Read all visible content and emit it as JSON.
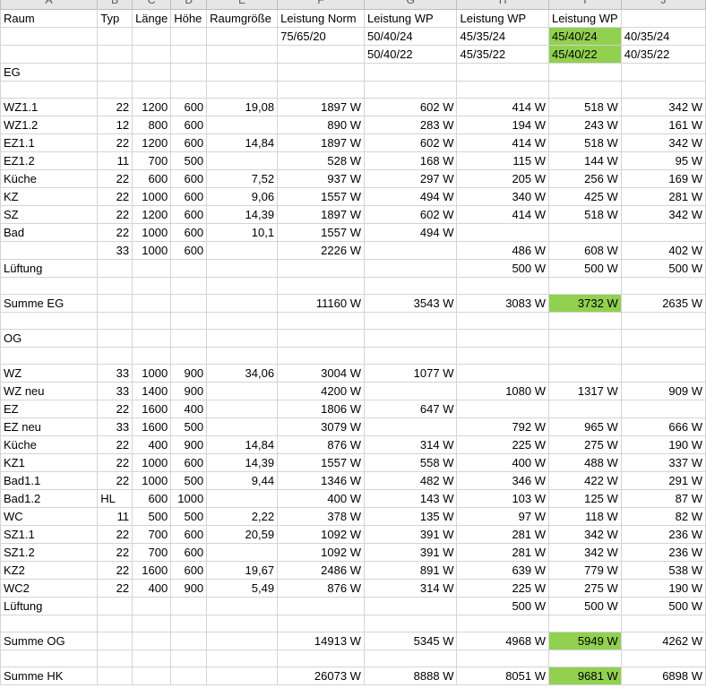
{
  "columns": [
    "A",
    "B",
    "C",
    "D",
    "E",
    "F",
    "G",
    "H",
    "I",
    "J"
  ],
  "highlight_color": "#92d050",
  "rows": [
    [
      "Raum",
      "Typ",
      "Länge",
      "Höhe",
      "Raumgröße",
      "Leistung Norm",
      "Leistung WP",
      "Leistung WP",
      "Leistung WP",
      ""
    ],
    [
      "",
      "",
      "",
      "",
      "",
      "75/65/20",
      "50/40/24",
      "45/35/24",
      "45/40/24",
      "40/35/24"
    ],
    [
      "",
      "",
      "",
      "",
      "",
      "",
      "50/40/22",
      "45/35/22",
      "45/40/22",
      "40/35/22"
    ],
    [
      "EG",
      "",
      "",
      "",
      "",
      "",
      "",
      "",
      "",
      ""
    ],
    [
      "",
      "",
      "",
      "",
      "",
      "",
      "",
      "",
      "",
      ""
    ],
    [
      "WZ1.1",
      "22",
      "1200",
      "600",
      "19,08",
      "1897 W",
      "602 W",
      "414 W",
      "518 W",
      "342 W"
    ],
    [
      "WZ1.2",
      "12",
      "800",
      "600",
      "",
      "890 W",
      "283 W",
      "194 W",
      "243 W",
      "161 W"
    ],
    [
      "EZ1.1",
      "22",
      "1200",
      "600",
      "14,84",
      "1897 W",
      "602 W",
      "414 W",
      "518 W",
      "342 W"
    ],
    [
      "EZ1.2",
      "11",
      "700",
      "500",
      "",
      "528 W",
      "168 W",
      "115 W",
      "144 W",
      "95 W"
    ],
    [
      "Küche",
      "22",
      "600",
      "600",
      "7,52",
      "937 W",
      "297 W",
      "205 W",
      "256 W",
      "169 W"
    ],
    [
      "KZ",
      "22",
      "1000",
      "600",
      "9,06",
      "1557 W",
      "494 W",
      "340 W",
      "425 W",
      "281 W"
    ],
    [
      "SZ",
      "22",
      "1200",
      "600",
      "14,39",
      "1897 W",
      "602 W",
      "414 W",
      "518 W",
      "342 W"
    ],
    [
      "Bad",
      "22",
      "1000",
      "600",
      "10,1",
      "1557 W",
      "494 W",
      "",
      "",
      ""
    ],
    [
      "",
      "33",
      "1000",
      "600",
      "",
      "2226 W",
      "",
      "486 W",
      "608 W",
      "402 W"
    ],
    [
      "Lüftung",
      "",
      "",
      "",
      "",
      "",
      "",
      "500 W",
      "500 W",
      "500 W"
    ],
    [
      "",
      "",
      "",
      "",
      "",
      "",
      "",
      "",
      "",
      ""
    ],
    [
      "Summe EG",
      "",
      "",
      "",
      "",
      "11160 W",
      "3543 W",
      "3083 W",
      "3732 W",
      "2635 W"
    ],
    [
      "",
      "",
      "",
      "",
      "",
      "",
      "",
      "",
      "",
      ""
    ],
    [
      "OG",
      "",
      "",
      "",
      "",
      "",
      "",
      "",
      "",
      ""
    ],
    [
      "",
      "",
      "",
      "",
      "",
      "",
      "",
      "",
      "",
      ""
    ],
    [
      "WZ",
      "33",
      "1000",
      "900",
      "34,06",
      "3004 W",
      "1077 W",
      "",
      "",
      ""
    ],
    [
      "WZ neu",
      "33",
      "1400",
      "900",
      "",
      "4200 W",
      "",
      "1080 W",
      "1317 W",
      "909 W"
    ],
    [
      "EZ",
      "22",
      "1600",
      "400",
      "",
      "1806 W",
      "647 W",
      "",
      "",
      ""
    ],
    [
      "EZ neu",
      "33",
      "1600",
      "500",
      "",
      "3079 W",
      "",
      "792 W",
      "965 W",
      "666 W"
    ],
    [
      "Küche",
      "22",
      "400",
      "900",
      "14,84",
      "876 W",
      "314 W",
      "225 W",
      "275 W",
      "190 W"
    ],
    [
      "KZ1",
      "22",
      "1000",
      "600",
      "14,39",
      "1557 W",
      "558 W",
      "400 W",
      "488 W",
      "337 W"
    ],
    [
      "Bad1.1",
      "22",
      "1000",
      "500",
      "9,44",
      "1346 W",
      "482 W",
      "346 W",
      "422 W",
      "291 W"
    ],
    [
      "Bad1.2",
      "HL",
      "600",
      "1000",
      "",
      "400 W",
      "143 W",
      "103 W",
      "125 W",
      "87 W"
    ],
    [
      "WC",
      "11",
      "500",
      "500",
      "2,22",
      "378 W",
      "135 W",
      "97 W",
      "118 W",
      "82 W"
    ],
    [
      "SZ1.1",
      "22",
      "700",
      "600",
      "20,59",
      "1092 W",
      "391 W",
      "281 W",
      "342 W",
      "236 W"
    ],
    [
      "SZ1.2",
      "22",
      "700",
      "600",
      "",
      "1092 W",
      "391 W",
      "281 W",
      "342 W",
      "236 W"
    ],
    [
      "KZ2",
      "22",
      "1600",
      "600",
      "19,67",
      "2486 W",
      "891 W",
      "639 W",
      "779 W",
      "538 W"
    ],
    [
      "WC2",
      "22",
      "400",
      "900",
      "5,49",
      "876 W",
      "314 W",
      "225 W",
      "275 W",
      "190 W"
    ],
    [
      "Lüftung",
      "",
      "",
      "",
      "",
      "",
      "",
      "500 W",
      "500 W",
      "500 W"
    ],
    [
      "",
      "",
      "",
      "",
      "",
      "",
      "",
      "",
      "",
      ""
    ],
    [
      "Summe OG",
      "",
      "",
      "",
      "",
      "14913 W",
      "5345 W",
      "4968 W",
      "5949 W",
      "4262 W"
    ],
    [
      "",
      "",
      "",
      "",
      "",
      "",
      "",
      "",
      "",
      ""
    ],
    [
      "Summe HK",
      "",
      "",
      "",
      "",
      "26073 W",
      "8888 W",
      "8051 W",
      "9681 W",
      "6898 W"
    ]
  ],
  "highlighted_cells": [
    [
      1,
      8
    ],
    [
      2,
      8
    ],
    [
      16,
      8
    ],
    [
      35,
      8
    ],
    [
      37,
      8
    ]
  ]
}
